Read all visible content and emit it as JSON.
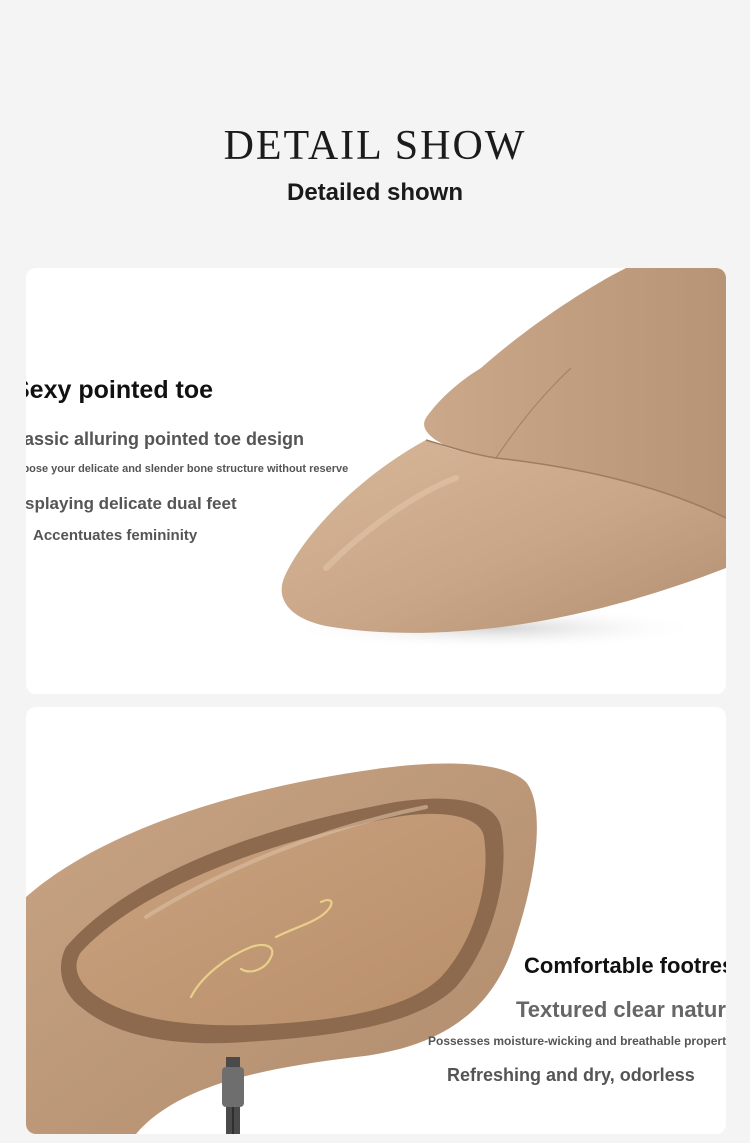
{
  "header": {
    "title": "DETAIL SHOW",
    "subtitle": "Detailed shown"
  },
  "section_toe": {
    "heading": "Sexy pointed toe",
    "line1": "Classic alluring pointed toe design",
    "line2": "Expose your delicate and slender bone structure without reserve",
    "line3": "Displaying delicate dual feet",
    "line4": "Accentuates femininity"
  },
  "section_footrest": {
    "heading": "Comfortable footrest",
    "line1": "Textured clear natural",
    "line2": "Possesses moisture-wicking and breathable properties",
    "line3": "Refreshing and dry, odorless"
  },
  "colors": {
    "background": "#f4f4f4",
    "card": "#ffffff",
    "leather": "#c9a789",
    "leather_dark": "#a9876a"
  },
  "icons": [
    "pointed-toe-shoe-photo",
    "insole-shoe-photo",
    "zipper-icon"
  ]
}
